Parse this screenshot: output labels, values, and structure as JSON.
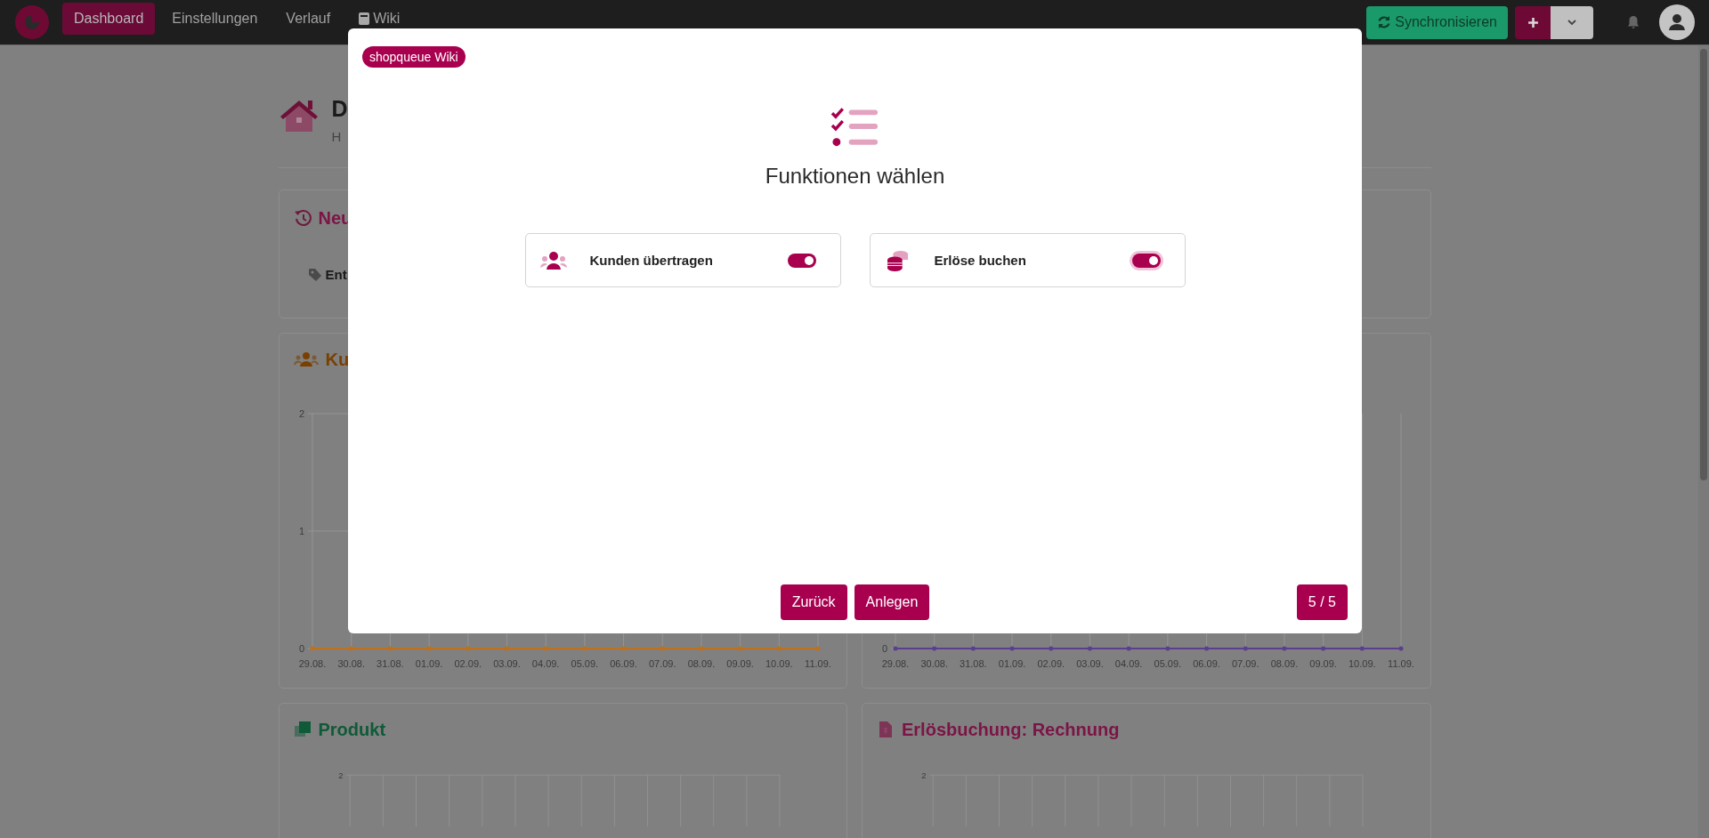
{
  "navbar": {
    "items": [
      {
        "label": "Dashboard",
        "selected": true,
        "kind": "text"
      },
      {
        "label": "Einstellungen",
        "selected": false,
        "kind": "text"
      },
      {
        "label": "Verlauf",
        "selected": false,
        "kind": "text"
      },
      {
        "label": "Wiki",
        "selected": false,
        "kind": "doc"
      }
    ],
    "sync_button": "Synchronisieren"
  },
  "page_header": {
    "title": "D",
    "subtitle": "H"
  },
  "news_card": {
    "title": "Neu",
    "entry": "Ent"
  },
  "chart_cards": [
    {
      "title": "Ku",
      "color": "#7a4000",
      "chart_data": {
        "type": "line",
        "grid": true,
        "categories": [
          "29.08.",
          "30.08.",
          "31.08.",
          "01.09.",
          "02.09.",
          "03.09.",
          "04.09.",
          "05.09.",
          "06.09.",
          "07.09.",
          "08.09.",
          "09.09.",
          "10.09.",
          "11.09."
        ],
        "ylim": [
          0,
          2
        ],
        "yticks": [
          0,
          1,
          2
        ],
        "series": [
          {
            "color": "#c0701a",
            "values": [
              0,
              0,
              0,
              0,
              0,
              0,
              0,
              0,
              0,
              0,
              0,
              0,
              0,
              0
            ]
          }
        ]
      }
    },
    {
      "color": "#5b3e8f",
      "y_tick": "0",
      "x_labels": [
        "29.08.",
        "30.08.",
        "31.08.",
        "01.09.",
        "02.09.",
        "03.09.",
        "04.09.",
        "05.09.",
        "06.09.",
        "07.09.",
        "08.09.",
        "09.09.",
        "10.09.",
        "11.09."
      ]
    }
  ],
  "lower_cards": [
    {
      "title": "Produkt",
      "kind": "product",
      "color": "#0f5a38",
      "y_tick": "2"
    },
    {
      "title": "Erlösbuchung: Rechnung",
      "kind": "invoice",
      "color": "#7c1446",
      "y_tick": "2"
    }
  ],
  "modal": {
    "badge": "shopqueue Wiki",
    "title": "Funktionen wählen",
    "features": [
      {
        "label": "Kunden übertragen",
        "kind": "customers",
        "on": true,
        "focused": false
      },
      {
        "label": "Erlöse buchen",
        "kind": "revenue",
        "on": true,
        "focused": true
      }
    ],
    "buttons": [
      "Zurück",
      "Anlegen"
    ],
    "step": "5 / 5"
  }
}
